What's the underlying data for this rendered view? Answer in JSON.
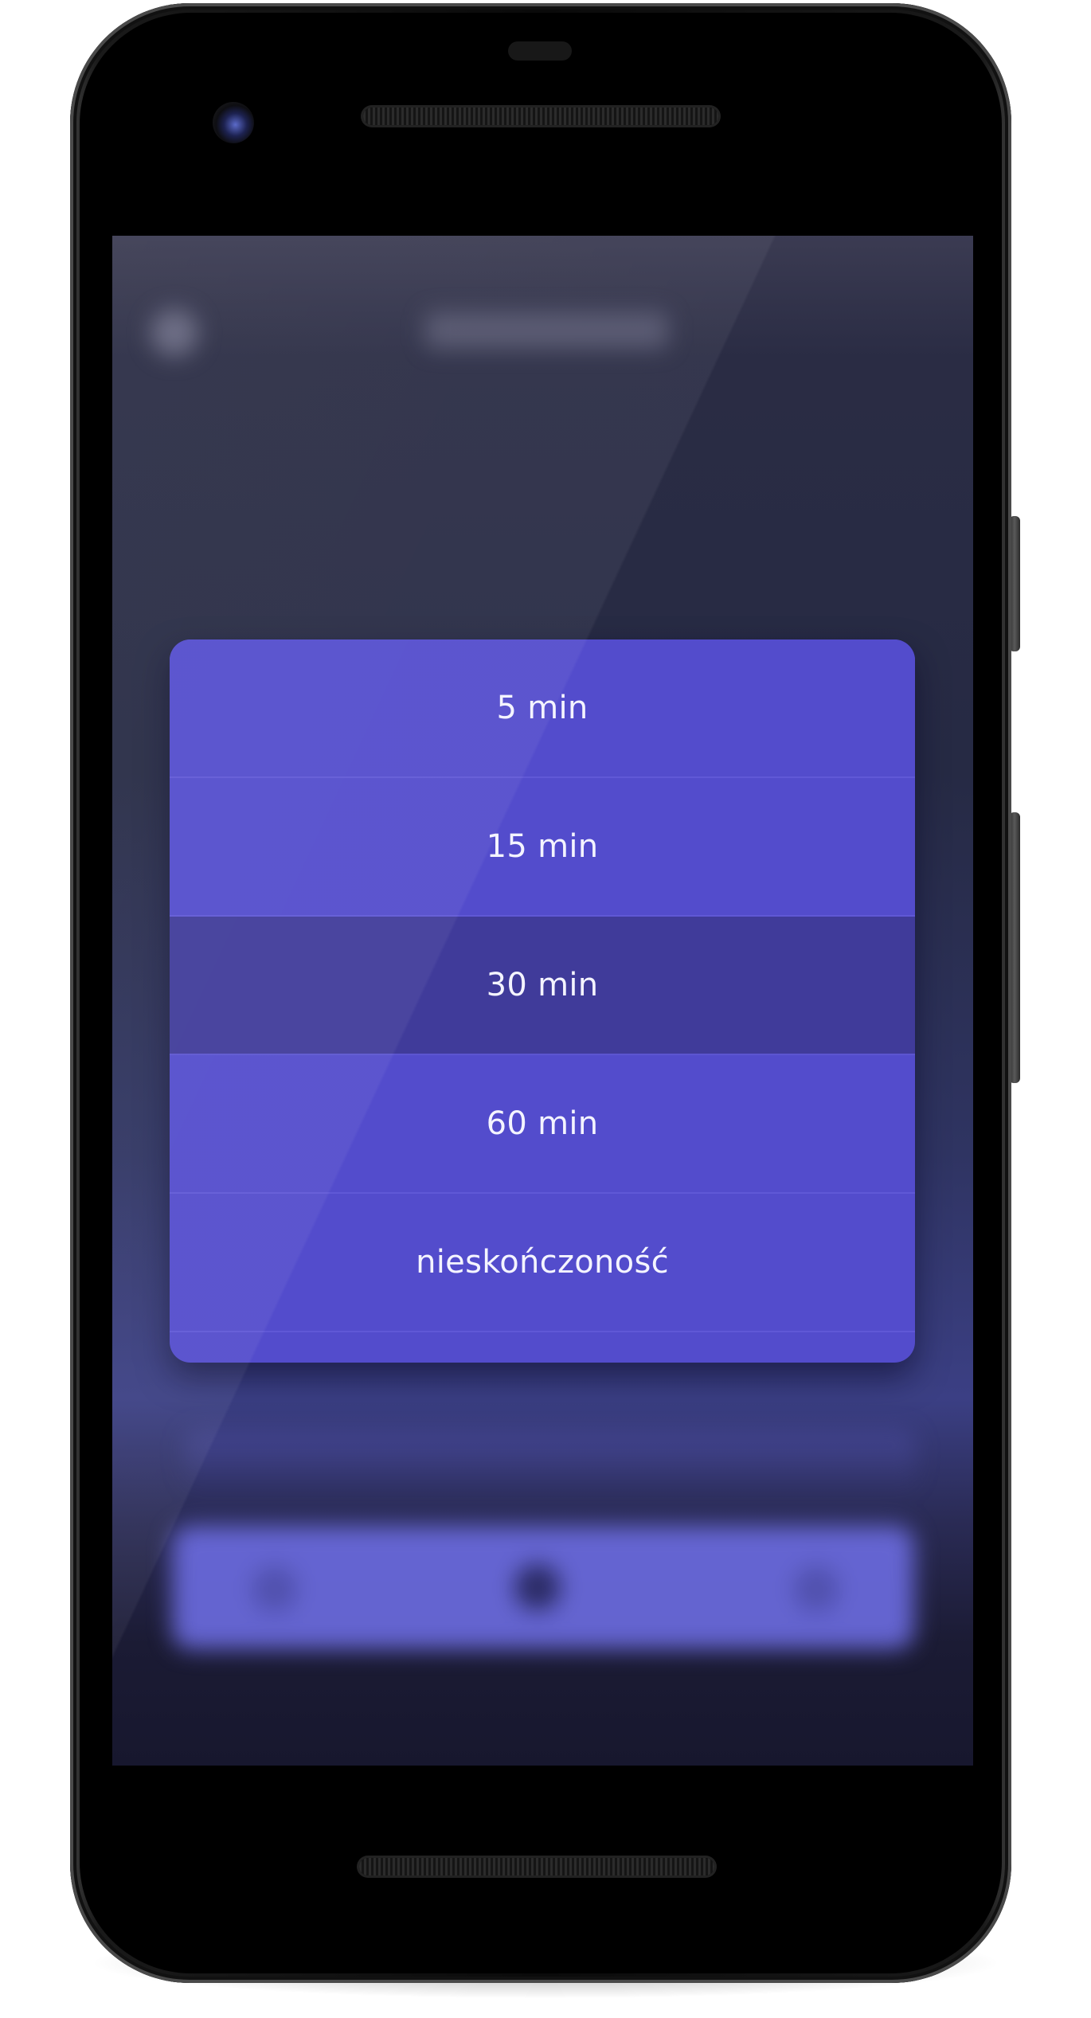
{
  "screen": {
    "status": "blurred background behind picker dialog"
  },
  "duration_picker": {
    "options": [
      {
        "label": "5 min",
        "selected": false
      },
      {
        "label": "15 min",
        "selected": false
      },
      {
        "label": "30 min",
        "selected": true
      },
      {
        "label": "60 min",
        "selected": false
      },
      {
        "label": "nieskończoność",
        "selected": false
      }
    ],
    "colors": {
      "dialog_background": "#534ccc",
      "selected_background": "#403b9a",
      "text": "#f4f4ff"
    }
  },
  "icons": {
    "camera": "front-camera-icon"
  }
}
